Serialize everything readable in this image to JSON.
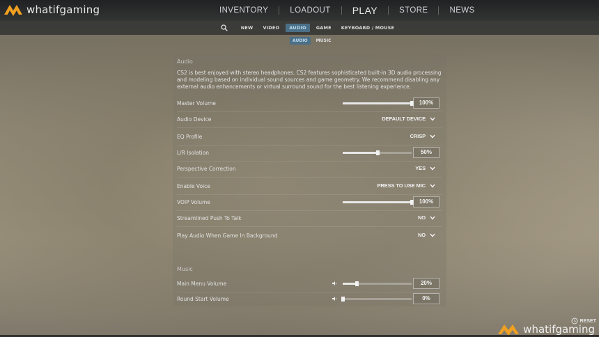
{
  "brand": {
    "name": "whatifgaming",
    "color": "#f0a020"
  },
  "nav": {
    "items": [
      {
        "label": "INVENTORY"
      },
      {
        "label": "LOADOUT"
      },
      {
        "label": "PLAY"
      },
      {
        "label": "STORE"
      },
      {
        "label": "NEWS"
      }
    ]
  },
  "tabs": {
    "items": [
      {
        "label": "NEW"
      },
      {
        "label": "VIDEO"
      },
      {
        "label": "AUDIO",
        "active": true
      },
      {
        "label": "GAME"
      },
      {
        "label": "KEYBOARD / MOUSE"
      }
    ]
  },
  "subtabs": {
    "items": [
      {
        "label": "AUDIO",
        "active": true
      },
      {
        "label": "MUSIC"
      }
    ]
  },
  "audio": {
    "title": "Audio",
    "description": "CS2 is best enjoyed with stereo headphones. CS2 features sophisticated built-in 3D audio processing and modeling based on individual sound sources and game geometry. We recommend disabling any external audio enhancements or virtual surround sound for the best listening experience.",
    "rows": [
      {
        "label": "Master Volume",
        "type": "slider",
        "value": "100%",
        "level": 1.0
      },
      {
        "label": "Audio Device",
        "type": "dropdown",
        "value": "DEFAULT DEVICE"
      },
      {
        "label": "EQ Profile",
        "type": "dropdown",
        "value": "CRISP"
      },
      {
        "label": "L/R Isolation",
        "type": "slider",
        "value": "50%",
        "level": 0.5
      },
      {
        "label": "Perspective Correction",
        "type": "dropdown",
        "value": "YES"
      },
      {
        "label": "Enable Voice",
        "type": "dropdown",
        "value": "PRESS TO USE MIC"
      },
      {
        "label": "VOIP Volume",
        "type": "slider",
        "value": "100%",
        "level": 1.0
      },
      {
        "label": "Streamlined Push To Talk",
        "type": "dropdown",
        "value": "NO"
      },
      {
        "label": "Play Audio When Game In Background",
        "type": "dropdown",
        "value": "NO"
      }
    ]
  },
  "music": {
    "title": "Music",
    "rows": [
      {
        "label": "Main Menu Volume",
        "value": "20%",
        "level": 0.2
      },
      {
        "label": "Round Start Volume",
        "value": "0%",
        "level": 0.0
      }
    ]
  },
  "footer": {
    "reset_label": "RESET"
  }
}
